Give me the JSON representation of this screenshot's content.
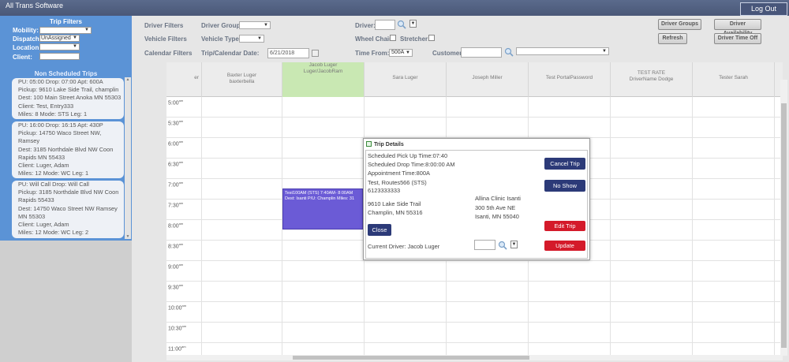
{
  "app": {
    "title": "All Trans Software",
    "logout_label": "Log Out"
  },
  "left": {
    "trip_filters_title": "Trip Filters",
    "mobility_label": "Mobility:",
    "mobility_value": "",
    "dispatch_label": "Dispatch:",
    "dispatch_value": "UnAssigned",
    "location_label": "Location:",
    "location_value": "",
    "client_label": "Client:",
    "client_value": "",
    "non_scheduled_title": "Non Scheduled Trips",
    "trips": [
      {
        "lines": [
          "PU: 05:00 Drop: 07:00 Apt: 600A",
          "Pickup: 9610 Lake Side Trail, champlin",
          "Dest: 100 Main Street Anoka MN 55303",
          "Client: Test, Entry333",
          "Miles: 8 Mode: STS Leg: 1"
        ]
      },
      {
        "lines": [
          "PU: 16:00 Drop: 16:15 Apt: 430P",
          "Pickup: 14750 Waco Street NW,",
          "Ramsey",
          "Dest: 3185 Northdale Blvd NW Coon",
          "Rapids MN 55433",
          "Client: Luger, Adam",
          "Miles: 12 Mode: WC Leg: 1"
        ]
      },
      {
        "lines": [
          "PU: Will Call Drop: Will Call",
          "Pickup: 3185 Northdale Blvd NW Coon",
          "Rapids 55433",
          "Dest: 14750 Waco Street NW Ramsey",
          "MN 55303",
          "Client: Luger, Adam",
          "Miles: 12 Mode: WC Leg: 2"
        ]
      }
    ]
  },
  "filters": {
    "driver_filters": "Driver Filters",
    "vehicle_filters": "Vehicle Filters",
    "calendar_filters": "Calendar Filters",
    "driver_group_label": "Driver Group:",
    "vehicle_type_label": "Vehicle Type:",
    "trip_date_label": "Trip/Calendar Date:",
    "trip_date_value": "6/21/2018",
    "driver_label": "Driver:",
    "wheelchair_label": "Wheel Chair:",
    "stretcher_label": "Stretcher:",
    "time_from_label": "Time From:",
    "time_from_value": "500A",
    "customer_label": "Customer:"
  },
  "buttons": {
    "driver_groups": "Driver Groups",
    "driver_availability": "Driver Availability",
    "refresh": "Refresh",
    "driver_time_off": "Driver Time Off"
  },
  "calendar": {
    "columns": [
      {
        "l1": "er",
        "l2": ""
      },
      {
        "l1": "Baxter Luger",
        "l2": "baxterbella"
      },
      {
        "l1": "Jacob Luger",
        "l2": "Luger/JacobRam"
      },
      {
        "l1": "Sara Luger",
        "l2": ""
      },
      {
        "l1": "Joseph Miller",
        "l2": ""
      },
      {
        "l1": "Test PortalPassword",
        "l2": ""
      },
      {
        "l1": "TEST RATE",
        "l2": "DriverName Dodge"
      },
      {
        "l1": "Tester Sarah",
        "l2": ""
      },
      {
        "l1": "",
        "l2": ""
      }
    ],
    "times": [
      {
        "h": "5:00",
        "s": "am"
      },
      {
        "h": "5:30",
        "s": "am"
      },
      {
        "h": "6:00",
        "s": "am"
      },
      {
        "h": "6:30",
        "s": "am"
      },
      {
        "h": "7:00",
        "s": "am"
      },
      {
        "h": "7:30",
        "s": "am"
      },
      {
        "h": "8:00",
        "s": "am"
      },
      {
        "h": "8:30",
        "s": "am"
      },
      {
        "h": "9:00",
        "s": "am"
      },
      {
        "h": "9:30",
        "s": "am"
      },
      {
        "h": "10:00",
        "s": "am"
      },
      {
        "h": "10:30",
        "s": "am"
      },
      {
        "h": "11:00",
        "s": "am"
      }
    ],
    "appointment": {
      "line1": "Test100AM (STS) 7:40AM- 8:00AM",
      "line2": "Dest: Isanti P/U: Champlin Miles: 31"
    }
  },
  "modal": {
    "title": "Trip Details",
    "pickup_time": "Scheduled Pick Up Time:07:40",
    "drop_time": "Scheduled Drop Time:8:00:00 AM",
    "appt_time": "Appointment Time:800A",
    "client": "Test, Routes566 (STS)",
    "phone": "6123333333",
    "from_addr1": "9610 Lake Side Trail",
    "from_addr2": "Champlin, MN 55316",
    "to_name": "Allina Clinic Isanti",
    "to_addr1": "300 5th Ave NE",
    "to_addr2": "Isanti, MN 55040",
    "current_driver": "Current Driver: Jacob Luger",
    "cancel_trip": "Cancel Trip",
    "no_show": "No Show",
    "edit_trip": "Edit Trip",
    "close": "Close",
    "update": "Update"
  }
}
